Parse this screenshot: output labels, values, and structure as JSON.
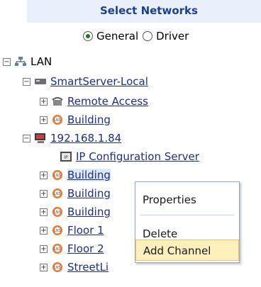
{
  "header": {
    "title": "Select Networks"
  },
  "radios": [
    {
      "label": "General",
      "selected": true
    },
    {
      "label": "Driver",
      "selected": false
    }
  ],
  "tree": {
    "lan": {
      "label": "LAN",
      "icon": "network-icon"
    },
    "smartserver": {
      "label": "SmartServer-Local",
      "icon": "server-icon"
    },
    "remote_access": {
      "label": "Remote Access",
      "icon": "phone-icon"
    },
    "building_1": {
      "label": "Building",
      "icon": "lns-icon"
    },
    "ip_node": {
      "label": "192.168.1.84",
      "icon": "computer-icon"
    },
    "ip_config": {
      "label": "IP Configuration Server",
      "icon": "config-server-icon"
    },
    "building_2": {
      "label": "Building",
      "icon": "lns-icon"
    },
    "building_3": {
      "label": "Building",
      "icon": "lns-icon"
    },
    "building_4": {
      "label": "Building",
      "icon": "lns-icon"
    },
    "floor_1": {
      "label": "Floor 1",
      "icon": "lns-icon"
    },
    "floor_2": {
      "label": "Floor 2",
      "icon": "lns-icon"
    },
    "streetlights": {
      "label": "StreetLi",
      "icon": "lns-icon"
    }
  },
  "context_menu": {
    "items": [
      {
        "label": "Properties"
      },
      {
        "label": "Delete"
      },
      {
        "label": "Add Channel",
        "highlighted": true
      }
    ]
  },
  "colors": {
    "header_bg": "#e9effb",
    "header_text": "#1f3f8c",
    "link": "#1e2f7a",
    "menu_highlight": "#fdf0bd"
  }
}
